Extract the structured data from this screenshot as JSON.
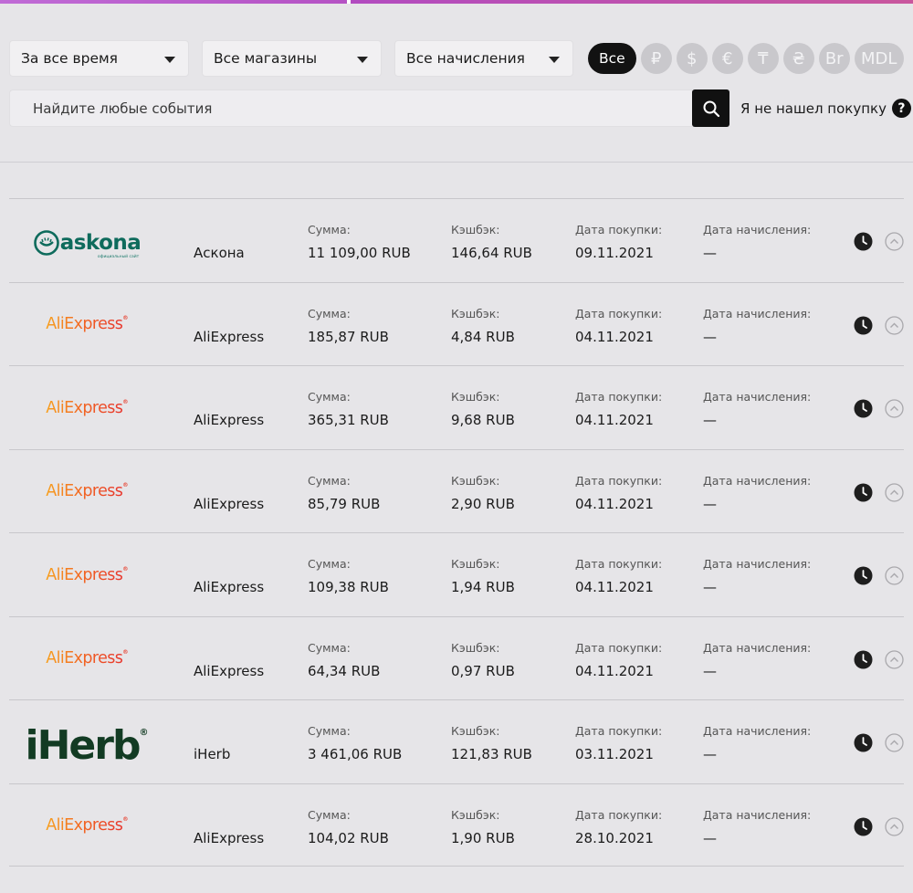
{
  "filters": {
    "period": "За все время",
    "shops": "Все магазины",
    "accruals": "Все начисления"
  },
  "currencies": [
    {
      "label": "Все",
      "active": true,
      "icon": "all"
    },
    {
      "label": "₽",
      "active": false,
      "icon": "ruble-icon"
    },
    {
      "label": "$",
      "active": false,
      "icon": "dollar-icon"
    },
    {
      "label": "€",
      "active": false,
      "icon": "euro-icon"
    },
    {
      "label": "₸",
      "active": false,
      "icon": "tenge-icon"
    },
    {
      "label": "₴",
      "active": false,
      "icon": "hryvnia-icon"
    },
    {
      "label": "Br",
      "active": false,
      "icon": "ruble-by-icon"
    },
    {
      "label": "MDL",
      "active": false,
      "icon": "leu-icon"
    }
  ],
  "search": {
    "placeholder": "Найдите любые события",
    "not_found": "Я не нашел покупку",
    "help_icon": "?"
  },
  "labels": {
    "sum": "Сумма:",
    "cashback": "Кэшбэк:",
    "purchase_date": "Дата покупки:",
    "accrual_date": "Дата начисления:"
  },
  "logos": {
    "askona": "askona",
    "askona_sub": "официальный сайт",
    "aliexpress": "AliExpress",
    "iherb": "iHerb",
    "trademark": "®"
  },
  "purchases": [
    {
      "logo": "askona",
      "shop": "Аскона",
      "sum": "11 109,00 RUB",
      "cashback": "146,64 RUB",
      "purchase_date": "09.11.2021",
      "accrual_date": "—"
    },
    {
      "logo": "aliexpress",
      "shop": "AliExpress",
      "sum": "185,87 RUB",
      "cashback": "4,84 RUB",
      "purchase_date": "04.11.2021",
      "accrual_date": "—"
    },
    {
      "logo": "aliexpress",
      "shop": "AliExpress",
      "sum": "365,31 RUB",
      "cashback": "9,68 RUB",
      "purchase_date": "04.11.2021",
      "accrual_date": "—"
    },
    {
      "logo": "aliexpress",
      "shop": "AliExpress",
      "sum": "85,79 RUB",
      "cashback": "2,90 RUB",
      "purchase_date": "04.11.2021",
      "accrual_date": "—"
    },
    {
      "logo": "aliexpress",
      "shop": "AliExpress",
      "sum": "109,38 RUB",
      "cashback": "1,94 RUB",
      "purchase_date": "04.11.2021",
      "accrual_date": "—"
    },
    {
      "logo": "aliexpress",
      "shop": "AliExpress",
      "sum": "64,34 RUB",
      "cashback": "0,97 RUB",
      "purchase_date": "04.11.2021",
      "accrual_date": "—"
    },
    {
      "logo": "iherb",
      "shop": "iHerb",
      "sum": "3 461,06 RUB",
      "cashback": "121,83 RUB",
      "purchase_date": "03.11.2021",
      "accrual_date": "—"
    },
    {
      "logo": "aliexpress",
      "shop": "AliExpress",
      "sum": "104,02 RUB",
      "cashback": "1,90 RUB",
      "purchase_date": "28.10.2021",
      "accrual_date": "—"
    }
  ],
  "colors": {
    "accent_dark": "#121212",
    "inactive_currency": "#c9c8cc",
    "askona_green": "#0e6b5c",
    "iherb_green": "#123b23"
  }
}
